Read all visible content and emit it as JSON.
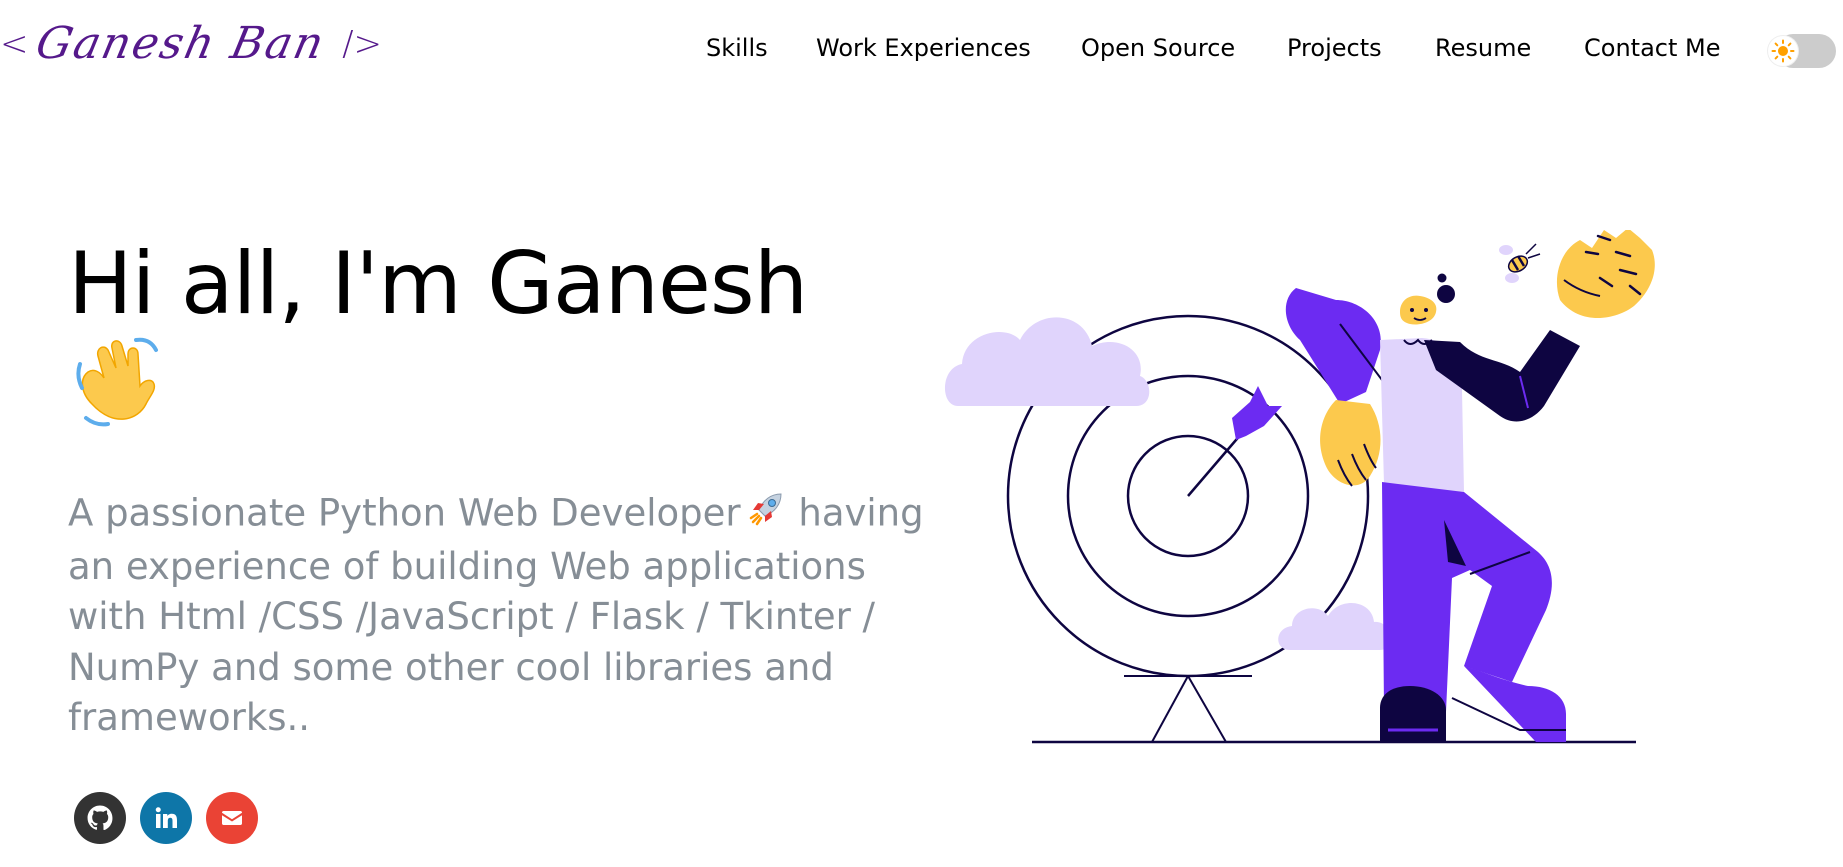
{
  "header": {
    "logo_open": "<",
    "logo_signature": "Ganesh Ban",
    "logo_close": "/>",
    "nav": [
      {
        "label": "Skills"
      },
      {
        "label": "Work Experiences"
      },
      {
        "label": "Open Source"
      },
      {
        "label": "Projects"
      },
      {
        "label": "Resume"
      },
      {
        "label": "Contact Me"
      }
    ],
    "theme_toggle": {
      "state": "light",
      "icon": "sun-icon"
    }
  },
  "hero": {
    "title": "Hi all, I'm Ganesh",
    "title_emoji": "waving-hand-icon",
    "subtitle": "A passionate Python Web Developer",
    "subtitle_emoji": "rocket-icon",
    "subtitle_rest": "having an experience of building Web applications with Html /CSS /JavaScript / Flask / Tkinter / NumPy and some other cool libraries and frameworks.."
  },
  "socials": [
    {
      "name": "github",
      "icon": "github-icon",
      "color": "#333333"
    },
    {
      "name": "linkedin",
      "icon": "linkedin-icon",
      "color": "#0e76a8"
    },
    {
      "name": "email",
      "icon": "mail-icon",
      "color": "#ea4335"
    }
  ],
  "colors": {
    "brand": "#55198b",
    "subtitle_text": "#868e96",
    "illustration_purple": "#6c2bf2",
    "illustration_lavender": "#e0d4fc",
    "illustration_yellow": "#fcc94d",
    "illustration_navy": "#0e0541"
  }
}
